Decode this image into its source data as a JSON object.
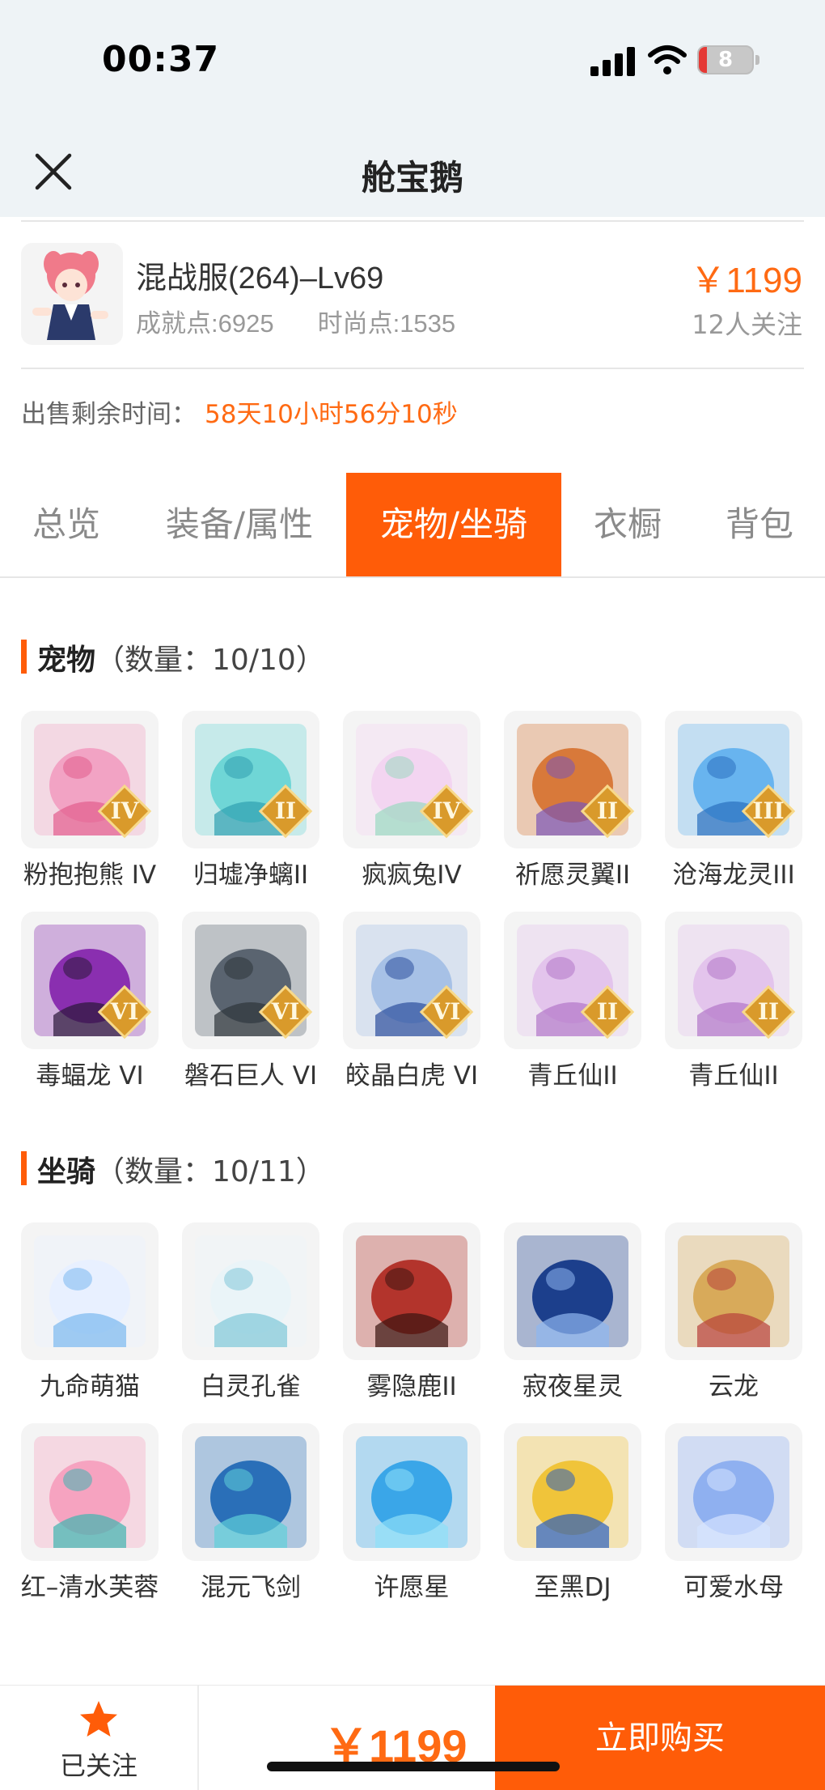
{
  "status_bar": {
    "time": "00:37",
    "battery": "8"
  },
  "nav": {
    "title": "舱宝鹅"
  },
  "listing": {
    "server": "混战服(264)–Lv69",
    "achievement": "成就点:6925",
    "fashion": "时尚点:1535",
    "price": "￥1199",
    "followers": "12人关注"
  },
  "timer": {
    "label": "出售剩余时间：",
    "value": "58天10小时56分10秒"
  },
  "tabs": [
    {
      "label": "总览"
    },
    {
      "label": "装备/属性"
    },
    {
      "label": "宠物/坐骑"
    },
    {
      "label": "衣橱"
    },
    {
      "label": "背包"
    }
  ],
  "pets": {
    "title": "宠物",
    "count": "（数量：10/10）",
    "items": [
      {
        "name": "粉抱抱熊 IV",
        "rank": "IV",
        "color": "#f2a3c4",
        "accent": "#e25c8d"
      },
      {
        "name": "归墟净螭II",
        "rank": "II",
        "color": "#6fd6d6",
        "accent": "#2f9fb0"
      },
      {
        "name": "疯疯兔IV",
        "rank": "IV",
        "color": "#f3d5f1",
        "accent": "#9ad8c0"
      },
      {
        "name": "祈愿灵翼II",
        "rank": "II",
        "color": "#d8793a",
        "accent": "#7a56b8"
      },
      {
        "name": "沧海龙灵III",
        "rank": "III",
        "color": "#68b4ef",
        "accent": "#2a6fbf"
      },
      {
        "name": "毒蝠龙 VI",
        "rank": "VI",
        "color": "#8a2fb0",
        "accent": "#2a1738"
      },
      {
        "name": "磐石巨人 VI",
        "rank": "VI",
        "color": "#5a6470",
        "accent": "#2e343b"
      },
      {
        "name": "皎晶白虎 VI",
        "rank": "VI",
        "color": "#a7c1e6",
        "accent": "#2c4f9c"
      },
      {
        "name": "青丘仙II",
        "rank": "II",
        "color": "#e3c4ec",
        "accent": "#b276c9"
      },
      {
        "name": "青丘仙II",
        "rank": "II",
        "color": "#e3c4ec",
        "accent": "#b276c9"
      }
    ]
  },
  "mounts": {
    "title": "坐骑",
    "count": "（数量：10/11）",
    "items": [
      {
        "name": "九命萌猫",
        "color": "#e8f0ff",
        "accent": "#7ab8f0"
      },
      {
        "name": "白灵孔雀",
        "color": "#eaf4f8",
        "accent": "#7fc7d8"
      },
      {
        "name": "雾隐鹿II",
        "color": "#b3342c",
        "accent": "#3a1410"
      },
      {
        "name": "寂夜星灵",
        "color": "#1c3f8c",
        "accent": "#8fb6f0"
      },
      {
        "name": "云龙",
        "color": "#d8aa5a",
        "accent": "#b8403a"
      },
      {
        "name": "红–清水芙蓉",
        "color": "#f6a3c0",
        "accent": "#3fb5b0"
      },
      {
        "name": "混元飞剑",
        "color": "#2a6fb8",
        "accent": "#5fd0d8"
      },
      {
        "name": "许愿星",
        "color": "#3aa6e8",
        "accent": "#8fe0f8"
      },
      {
        "name": "至黑DJ",
        "color": "#f0c43a",
        "accent": "#2a5fc0"
      },
      {
        "name": "可爱水母",
        "color": "#8fb0f0",
        "accent": "#d6e4ff"
      }
    ]
  },
  "bottom": {
    "follow_label": "已关注",
    "price": "￥1199",
    "buy_label": "立即购买"
  },
  "colors": {
    "accent": "#ff5c08",
    "price": "#ff6a13",
    "nav_bg": "#eef3f6"
  }
}
